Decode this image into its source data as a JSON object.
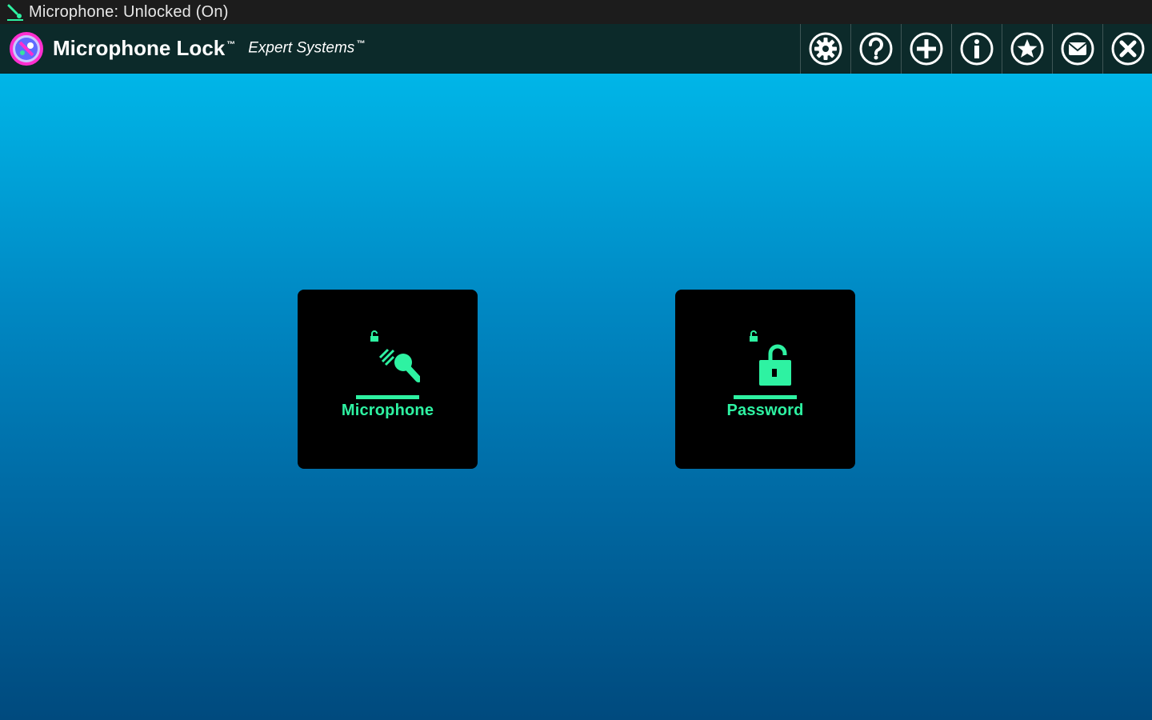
{
  "status_bar": {
    "icon": "microphone-status-icon",
    "text": "Microphone: Unlocked (On)"
  },
  "app_bar": {
    "title": "Microphone Lock",
    "title_tm": "™",
    "subtitle": "Expert Systems",
    "subtitle_tm": "™",
    "logo": "microphone-lock-logo",
    "toolbar": [
      {
        "name": "settings",
        "icon": "gear-icon"
      },
      {
        "name": "help",
        "icon": "question-icon"
      },
      {
        "name": "add",
        "icon": "plus-icon"
      },
      {
        "name": "info",
        "icon": "info-icon"
      },
      {
        "name": "rate",
        "icon": "star-icon"
      },
      {
        "name": "email",
        "icon": "mail-icon"
      },
      {
        "name": "close",
        "icon": "close-icon"
      }
    ]
  },
  "tiles": [
    {
      "label": "Microphone",
      "icon": "microphone-icon"
    },
    {
      "label": "Password",
      "icon": "padlock-unlocked-icon"
    }
  ],
  "colors": {
    "accent": "#2ef2a2",
    "status_bar_bg": "#1c1c1c",
    "app_bar_bg": "#0c2a2a",
    "gradient_top": "#00b6e8",
    "gradient_bottom": "#004a7e",
    "tile_bg": "#000000"
  }
}
